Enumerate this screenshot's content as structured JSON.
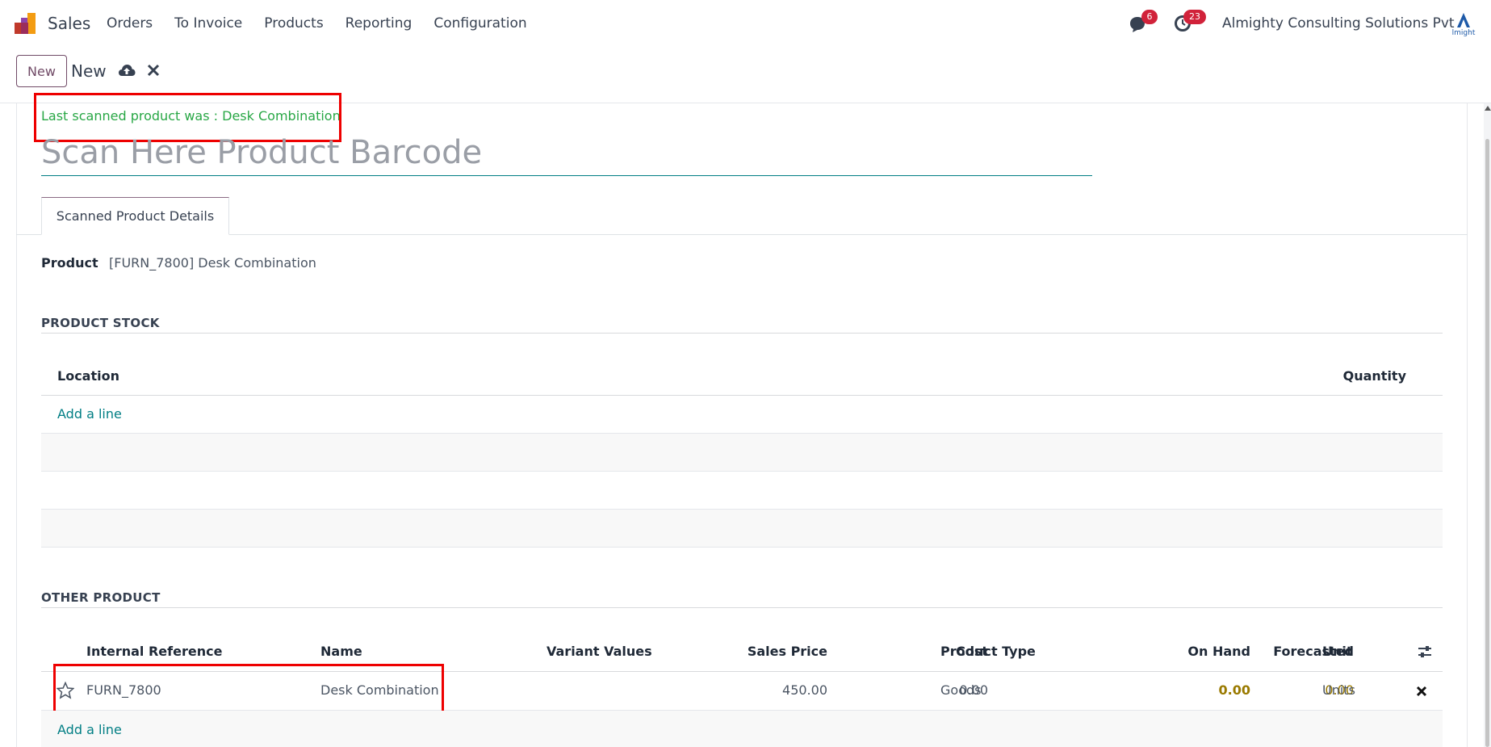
{
  "navbar": {
    "app_name": "Sales",
    "menu": [
      "Orders",
      "To Invoice",
      "Products",
      "Reporting",
      "Configuration"
    ],
    "messages_count": "6",
    "activities_count": "23",
    "company_name": "Almighty Consulting Solutions Pvt",
    "company_logo_text": "lmight"
  },
  "control_panel": {
    "new_button": "New",
    "breadcrumb": "New",
    "save_icon": "cloud-upload-icon",
    "discard_icon": "close-icon"
  },
  "form": {
    "last_scanned": "Last scanned product was : Desk Combination",
    "barcode_placeholder": "Scan Here Product Barcode",
    "tab_label": "Scanned Product Details",
    "product_label": "Product",
    "product_value": "[FURN_7800] Desk Combination"
  },
  "product_stock": {
    "title": "PRODUCT STOCK",
    "columns": [
      "Location",
      "Quantity"
    ],
    "add_line": "Add a line"
  },
  "other_product": {
    "title": "OTHER PRODUCT",
    "columns": [
      "Internal Reference",
      "Name",
      "Variant Values",
      "Sales Price",
      "Cost",
      "Product Type",
      "On Hand",
      "Forecasted",
      "Unit"
    ],
    "rows": [
      {
        "internal_reference": "FURN_7800",
        "name": "Desk Combination",
        "variant_values": "",
        "sales_price": "450.00",
        "cost": "0.00",
        "product_type": "Goods",
        "on_hand": "0.00",
        "forecasted": "0.00",
        "unit": "Units"
      }
    ],
    "add_line": "Add a line"
  },
  "colors": {
    "brand": "#714b67",
    "link": "#017e84",
    "success": "#28a745",
    "highlight": "#ee0000",
    "badge": "#d1223a"
  }
}
